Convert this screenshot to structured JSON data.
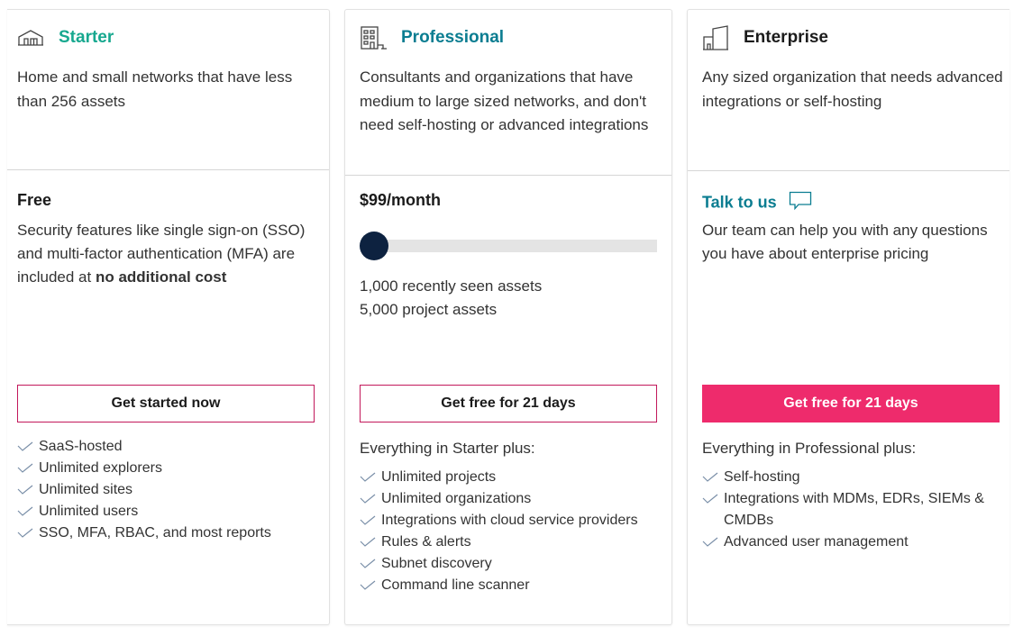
{
  "colors": {
    "starter_accent": "#17a88f",
    "professional_accent": "#0b7d91",
    "enterprise_name": "#1b1b1b",
    "talk_link": "#0b7d91",
    "primary_button": "#ee2b6c",
    "outline_button_border": "#c2185b",
    "slider_thumb": "#0d2240",
    "check": "#7a8fa8"
  },
  "plans": {
    "starter": {
      "icon": "home-network-icon",
      "name": "Starter",
      "description": "Home and small networks that have less than 256 assets",
      "price": "Free",
      "price_text_before": "Security features like single sign-on (SSO) and multi-factor authentication (MFA) are included at ",
      "price_text_bold": "no additional cost",
      "cta": "Get started now",
      "features": [
        "SaaS-hosted",
        "Unlimited explorers",
        "Unlimited sites",
        "Unlimited users",
        "SSO, MFA, RBAC, and most reports"
      ]
    },
    "professional": {
      "icon": "office-building-icon",
      "name": "Professional",
      "description": "Consultants and organizations that have medium to large sized networks, and don't need self-hosting or advanced integrations",
      "price": "$99/month",
      "slider_position": 0,
      "assets_recent": "1,000 recently seen assets",
      "assets_project": "5,000 project assets",
      "cta": "Get free for 21 days",
      "features_intro": "Everything in Starter plus:",
      "features": [
        "Unlimited projects",
        "Unlimited organizations",
        "Integrations with cloud service providers",
        "Rules & alerts",
        "Subnet discovery",
        "Command line scanner"
      ]
    },
    "enterprise": {
      "icon": "skyscraper-icon",
      "name": "Enterprise",
      "description": "Any sized organization that needs advanced integrations or self-hosting",
      "price": "Talk to us",
      "price_text": "Our team can help you with any questions you have about enterprise pricing",
      "cta": "Get free for 21 days",
      "features_intro": "Everything in Professional plus:",
      "features": [
        "Self-hosting",
        "Integrations with MDMs, EDRs, SIEMs & CMDBs",
        "Advanced user management"
      ]
    }
  }
}
